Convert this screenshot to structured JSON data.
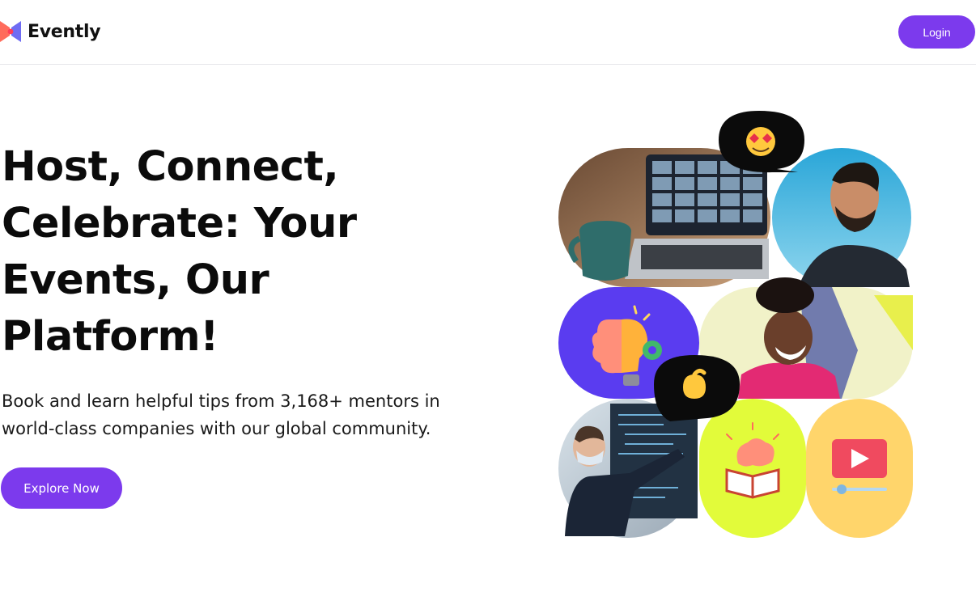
{
  "header": {
    "brand": "Evently",
    "logo_icon": "evently-logo-icon",
    "login_label": "Login"
  },
  "hero": {
    "title_lines": [
      "Host, Connect,",
      "Celebrate: Your",
      "Events, Our",
      "Platform!"
    ],
    "subtitle_lines": [
      "Book and learn helpful tips from 3,168+ mentors in",
      "world-class companies with our global community."
    ],
    "cta_label": "Explore Now"
  },
  "collage": {
    "tiles": [
      "laptop-video-call-photo",
      "smiling-man-photo",
      "brain-lightbulb-icon",
      "laughing-woman-photo",
      "man-presenting-code-photo",
      "brain-book-icon",
      "video-player-icon"
    ],
    "bubbles": [
      "heart-eyes-emoji",
      "pinched-fingers-emoji"
    ]
  },
  "colors": {
    "brand_purple": "#7c3aed",
    "lime": "#e2fb3a",
    "peach": "#ffd56b",
    "violet": "#5a3cf0",
    "text": "#0b0b0b"
  }
}
